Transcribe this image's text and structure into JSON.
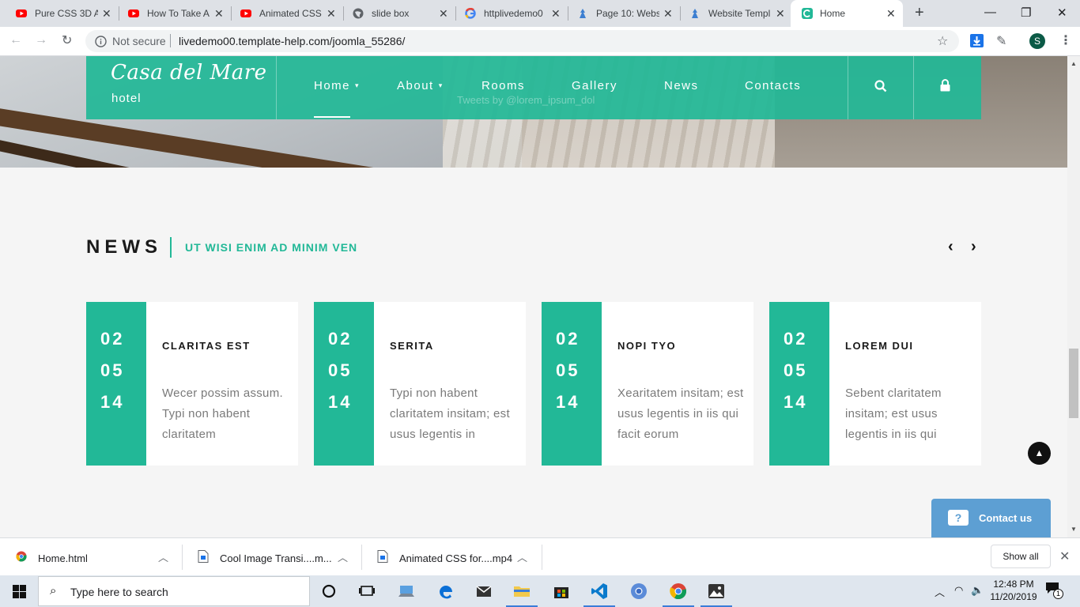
{
  "browser": {
    "tabs": [
      {
        "title": "Pure CSS 3D A",
        "icon": "youtube-icon",
        "active": false
      },
      {
        "title": "How To Take A",
        "icon": "youtube-icon",
        "active": false
      },
      {
        "title": "Animated CSS",
        "icon": "youtube-icon",
        "active": false
      },
      {
        "title": "slide box",
        "icon": "globe-icon",
        "active": false
      },
      {
        "title": "httplivedemo0",
        "icon": "google-icon",
        "active": false
      },
      {
        "title": "Page 10: Webs",
        "icon": "templatemonster-icon",
        "active": false
      },
      {
        "title": "Website Templ",
        "icon": "templatemonster-icon",
        "active": false
      },
      {
        "title": "Home",
        "icon": "site-icon",
        "active": true
      }
    ],
    "new_tab": "+",
    "security": "Not secure",
    "url": "livedemo00.template-help.com/joomla_55286/",
    "profile_initial": "S"
  },
  "site": {
    "logo": "Casa del Mare",
    "logo_sub": "hotel",
    "nav": [
      {
        "label": "Home",
        "dropdown": true,
        "active": true
      },
      {
        "label": "About",
        "dropdown": true,
        "active": false
      },
      {
        "label": "Rooms",
        "dropdown": false,
        "active": false
      },
      {
        "label": "Gallery",
        "dropdown": false,
        "active": false
      },
      {
        "label": "News",
        "dropdown": false,
        "active": false
      },
      {
        "label": "Contacts",
        "dropdown": false,
        "active": false
      }
    ],
    "tweets_ghost": "Tweets by @lorem_ipsum_dol",
    "news": {
      "title": "NEWS",
      "subtitle": "UT WISI ENIM AD MINIM VEN",
      "cards": [
        {
          "day": "02",
          "month": "05",
          "year": "14",
          "title": "CLARITAS EST",
          "body": "Wecer possim assum. Typi non habent claritatem"
        },
        {
          "day": "02",
          "month": "05",
          "year": "14",
          "title": "SERITA",
          "body": "Typi non habent claritatem insitam; est usus legentis in"
        },
        {
          "day": "02",
          "month": "05",
          "year": "14",
          "title": "NOPI TYO",
          "body": "Xearitatem insitam; est usus legentis in iis qui facit eorum"
        },
        {
          "day": "02",
          "month": "05",
          "year": "14",
          "title": "LOREM DUI",
          "body": "Sebent claritatem insitam; est usus legentis in iis qui"
        }
      ]
    },
    "contact_button": "Contact us",
    "accent_color": "#22b897"
  },
  "downloads": {
    "items": [
      {
        "name": "Home.html"
      },
      {
        "name": "Cool Image Transi....m..."
      },
      {
        "name": "Animated CSS for....mp4"
      }
    ],
    "show_all": "Show all"
  },
  "taskbar": {
    "search_placeholder": "Type here to search",
    "time": "12:48 PM",
    "date": "11/20/2019",
    "notification_count": "1"
  }
}
